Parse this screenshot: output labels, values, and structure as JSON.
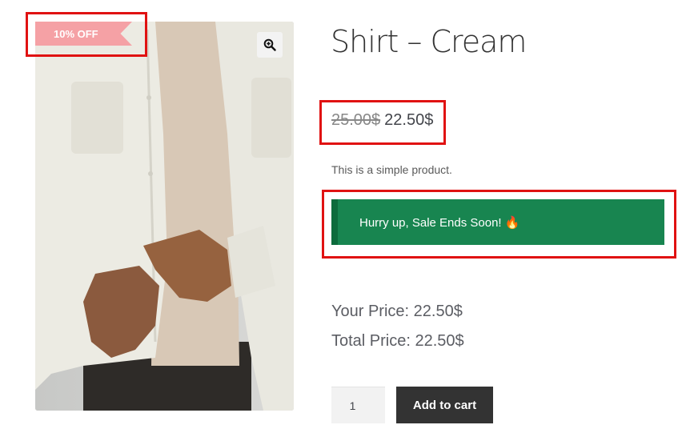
{
  "product": {
    "title": "Shirt – Cream",
    "badge": "10% OFF",
    "price_old": "25.00$",
    "price_new": "22.50$",
    "short_description": "This is a simple product.",
    "sale_notice": "Hurry up, Sale Ends Soon! 🔥",
    "your_price": "Your Price: 22.50$",
    "total_price": "Total Price: 22.50$",
    "quantity": "1",
    "add_to_cart_label": "Add to cart",
    "image_icon": "zoom-in-icon"
  },
  "colors": {
    "badge": "#f5a1a5",
    "notice_bg": "#188550",
    "button_bg": "#333333",
    "annotation": "#e01212"
  }
}
